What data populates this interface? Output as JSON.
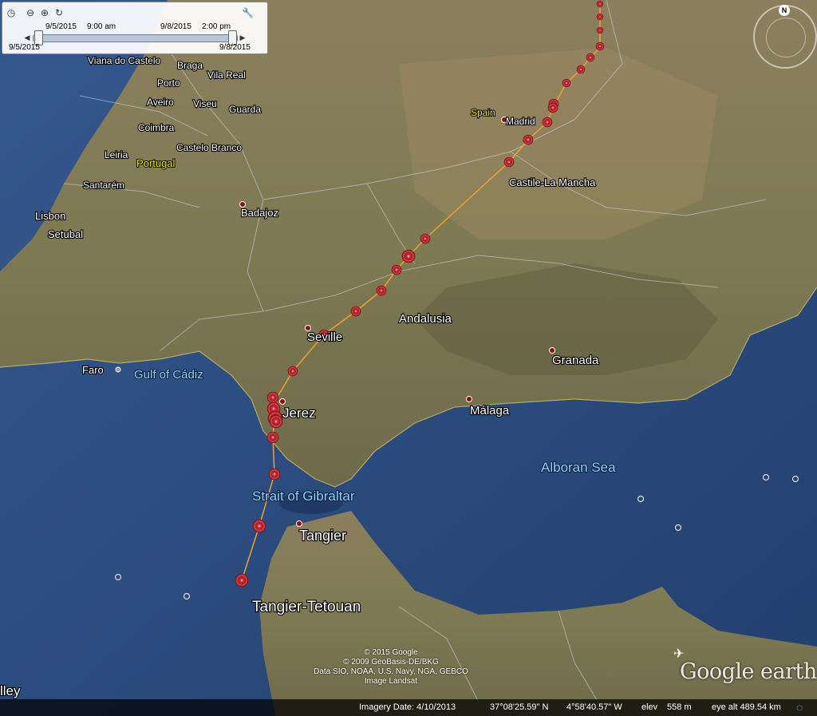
{
  "timeslider": {
    "start_date": "9/5/2015",
    "start_time": "9:00 am",
    "end_date": "9/8/2015",
    "end_time": "2:00 pm",
    "range_start": "9/5/2015",
    "range_end": "9/8/2015"
  },
  "navigation": {
    "north": "N"
  },
  "labels": {
    "countries": {
      "spain": "Spain",
      "portugal": "Portugal"
    },
    "cities": {
      "viana": "Viana do Castelo",
      "braga": "Braga",
      "porto": "Porto",
      "vila_real": "Vila Real",
      "aveiro": "Aveiro",
      "viseu": "Viseu",
      "guarda": "Guarda",
      "coimbra": "Coimbra",
      "leiria": "Leiria",
      "castelo_branco": "Castelo Branco",
      "santarem": "Santarém",
      "lisbon": "Lisbon",
      "setubal": "Setubal",
      "badajoz": "Badajoz",
      "madrid": "Madrid",
      "seville": "Seville",
      "granada": "Granada",
      "malaga": "Málaga",
      "jerez": "Jerez",
      "tangier": "Tangier",
      "faro": "Faro",
      "ley": "lley"
    },
    "regions": {
      "castile": "Castile-La Mancha",
      "andalusia": "Andalusia",
      "tangier_tetouan": "Tangier-Tetouan"
    },
    "seas": {
      "gulf_cadiz": "Gulf of Cádiz",
      "gibraltar": "Strait of Gibraltar",
      "alboran": "Alboran Sea"
    }
  },
  "attribution": {
    "line1": "© 2015 Google",
    "line2": "© 2009 GeoBasis-DE/BKG",
    "line3": "Data SIO, NOAA, U.S. Navy, NGA, GEBCO",
    "line4": "Image Landsat"
  },
  "logo": "Google earth",
  "status_bar": {
    "imagery_date": "Imagery Date: 4/10/2013",
    "lat": "37°08'25.59\" N",
    "lon": "4°58'40.57\" W",
    "elev_label": "elev",
    "elev": "558 m",
    "eye_alt": "eye alt 489.54 km"
  },
  "colors": {
    "track_line": "#f0a030",
    "track_marker": "#c0242a",
    "sea": "#2c4a7a",
    "land": "#8a8460"
  },
  "icons": {
    "clock": "clock-icon",
    "zoom_out": "zoom-out-icon",
    "zoom_in": "zoom-in-icon",
    "refresh": "refresh-icon",
    "settings": "wrench-icon",
    "airport": "airplane-icon"
  }
}
